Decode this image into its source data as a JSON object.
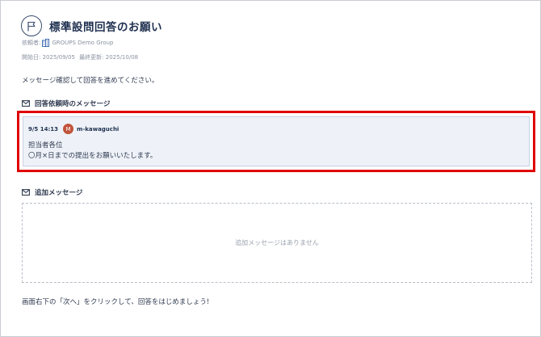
{
  "header": {
    "title": "標準設問回答のお願い",
    "requester_label": "依頼者:",
    "requester_org": "GROUPS Demo Group",
    "start_date": "開始日: 2025/09/05",
    "last_updated": "最終更新: 2025/10/08"
  },
  "intro_text": "メッセージ確認して回答を進めてください。",
  "request_message_section": {
    "heading": "回答依頼時のメッセージ",
    "message": {
      "timestamp": "9/5 14:13",
      "avatar_initial": "M",
      "author": "m-kawaguchi",
      "line1": "担当者各位",
      "line2": "〇月×日までの提出をお願いいたします。"
    }
  },
  "additional_section": {
    "heading": "追加メッセージ",
    "empty_text": "追加メッセージはありません"
  },
  "footer_note": "画面右下の「次へ」をクリックして、回答をはじめましょう!",
  "colors": {
    "accent_border": "#e00000",
    "message_bg": "#eef2f8",
    "avatar_bg": "#c0533a"
  }
}
